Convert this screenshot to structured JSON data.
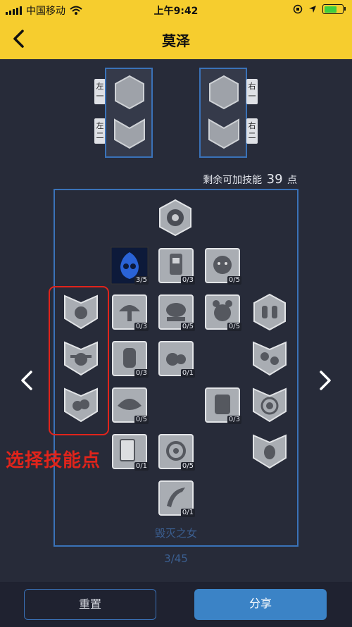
{
  "status_bar": {
    "carrier": "中国移动",
    "time": "上午9:42"
  },
  "nav": {
    "title": "莫泽"
  },
  "slots": {
    "left_1": "左一",
    "left_2": "左二",
    "right_1": "右一",
    "right_2": "右二"
  },
  "remaining": {
    "prefix": "剩余可加技能",
    "value": "39",
    "suffix": "点"
  },
  "skills": {
    "r1c2": "3/5",
    "r1c3": "0/3",
    "r1c4": "0/5",
    "r2c2": "0/3",
    "r2c3": "0/5",
    "r2c4": "0/5",
    "r3c2": "0/3",
    "r3c3": "0/1",
    "r4c2": "0/5",
    "r4c4": "0/3",
    "r5c2": "0/1",
    "r5c3": "0/5",
    "r6c3": "0/1"
  },
  "tree_name": "毁灭之女",
  "progress": "3/45",
  "annotation": "选择技能点",
  "buttons": {
    "reset": "重置",
    "share": "分享"
  },
  "colors": {
    "accent_yellow": "#f6cd2e",
    "frame_blue": "#3a72b8",
    "highlight_red": "#e0241b",
    "share_blue": "#3b83c6"
  }
}
